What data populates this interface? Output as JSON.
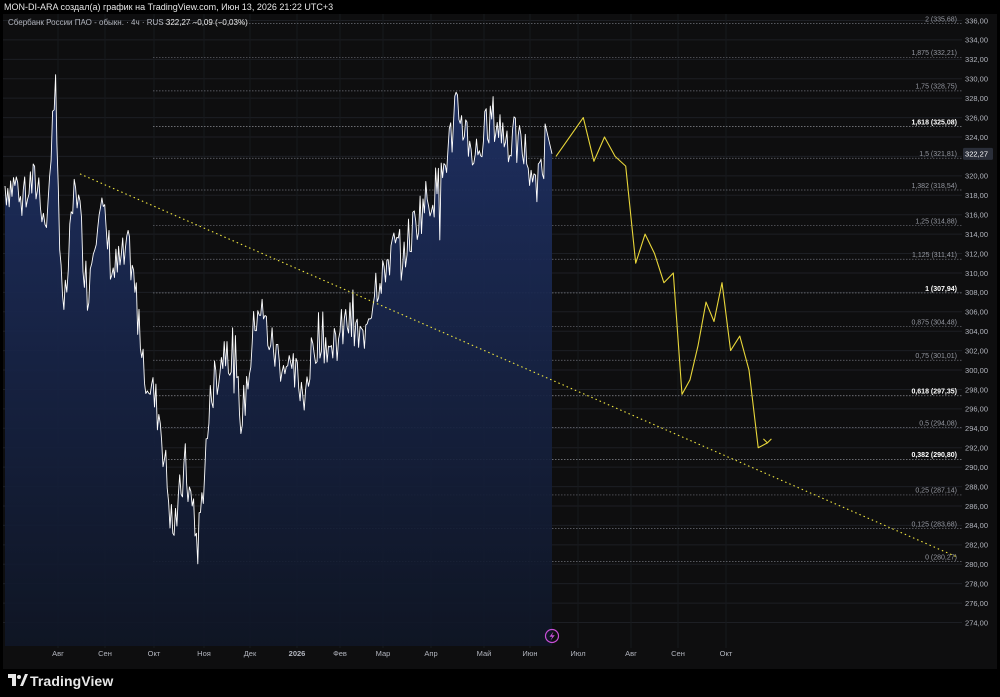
{
  "header": {
    "attribution": "MON-DI-ARA создал(а) график на TradingView.com, Июн 13, 2026 21:22 UTC+3"
  },
  "legend": {
    "symbol": "Сбербанк России ПАО - обыкн. · 4ч · RUS",
    "last": "322,27",
    "change": "−0,09 (−0,03%)"
  },
  "footer": {
    "brand": "TradingView"
  },
  "colors": {
    "background": "#0e0e0f",
    "price_line": "#ffffff",
    "area_fill": "#1c2c5a",
    "projection": "#e8d63a",
    "trendline": "#f0e640",
    "fib_line": "#6e7079",
    "axis_text": "#b2b5be",
    "badge": "#2a2e39",
    "lightning_icon": "#c84fd6"
  },
  "chart_data": {
    "type": "line",
    "title": "Сбербанк России ПАО - обыкн. · 4ч · RUS",
    "ylim": [
      274,
      336
    ],
    "yticks": [
      274,
      276,
      278,
      280,
      282,
      284,
      286,
      288,
      290,
      292,
      294,
      296,
      298,
      300,
      302,
      304,
      306,
      308,
      310,
      312,
      314,
      316,
      318,
      320,
      322,
      324,
      326,
      328,
      330,
      332,
      334,
      336
    ],
    "ytick_labels": [
      "274,00",
      "276,00",
      "278,00",
      "280,00",
      "282,00",
      "284,00",
      "286,00",
      "288,00",
      "290,00",
      "292,00",
      "294,00",
      "296,00",
      "298,00",
      "300,00",
      "302,00",
      "304,00",
      "306,00",
      "308,00",
      "310,00",
      "312,00",
      "314,00",
      "316,00",
      "318,00",
      "320,00",
      "322,00",
      "324,00",
      "326,00",
      "328,00",
      "330,00",
      "332,00",
      "334,00",
      "336,00"
    ],
    "x_axis": [
      "Авг",
      "Сен",
      "Окт",
      "Ноя",
      "Дек",
      "2026",
      "Фев",
      "Мар",
      "Апр",
      "Май",
      "Июн",
      "Июл",
      "Авг",
      "Сен",
      "Окт"
    ],
    "grid": true,
    "last_price": 322.27,
    "last_price_label": "322,27",
    "series": [
      {
        "type": "area",
        "style": "price",
        "x": [
          "Июл",
          "Июл",
          "Июл",
          "Авг",
          "Авг",
          "Авг",
          "Авг",
          "Сен",
          "Сен",
          "Сен",
          "Окт",
          "Окт",
          "Окт",
          "Окт",
          "Ноя",
          "Ноя",
          "Ноя",
          "Дек",
          "Дек",
          "Дек",
          "2026",
          "2026",
          "2026",
          "Фев",
          "Фев",
          "Фев",
          "Мар",
          "Мар",
          "Мар",
          "Апр",
          "Апр",
          "Апр",
          "Май",
          "Май",
          "Май",
          "Июн",
          "Июн"
        ],
        "values": [
          319,
          315,
          328,
          305,
          320,
          308,
          318,
          310,
          312,
          300,
          295,
          283,
          290,
          282,
          298,
          303,
          295,
          307,
          302,
          300,
          298,
          304,
          302,
          305,
          303,
          309,
          312,
          313,
          317,
          319,
          327,
          322,
          326,
          324,
          323,
          320,
          322.27
        ]
      },
      {
        "type": "line",
        "style": "projection",
        "x": [
          "Июн",
          "Июл",
          "Июл",
          "Июл",
          "Июл",
          "Июл",
          "Авг",
          "Авг",
          "Авг",
          "Авг",
          "Авг",
          "Сен",
          "Сен",
          "Сен",
          "Сен",
          "Сен",
          "Сен",
          "Окт",
          "Окт",
          "Окт",
          "Окт",
          "Окт"
        ],
        "values": [
          322,
          326,
          321.5,
          324,
          322,
          321,
          311,
          314,
          312,
          309,
          310,
          297.5,
          299,
          302.5,
          307,
          305,
          309,
          302,
          303.5,
          300,
          292,
          292.5
        ]
      },
      {
        "type": "line",
        "style": "dotted-trendline",
        "x": [
          "Авг",
          "Окт"
        ],
        "values": [
          320.2,
          280.7
        ]
      }
    ],
    "fib_levels": [
      {
        "ratio": "0",
        "price": 280.27,
        "label": "0 (280,27)",
        "bold": false
      },
      {
        "ratio": "0,125",
        "price": 283.68,
        "label": "0,125 (283,68)",
        "bold": false
      },
      {
        "ratio": "0,25",
        "price": 287.14,
        "label": "0,25 (287,14)",
        "bold": false
      },
      {
        "ratio": "0,382",
        "price": 290.8,
        "label": "0,382 (290,80)",
        "bold": true
      },
      {
        "ratio": "0,5",
        "price": 294.08,
        "label": "0,5 (294,08)",
        "bold": false
      },
      {
        "ratio": "0,618",
        "price": 297.35,
        "label": "0,618 (297,35)",
        "bold": true
      },
      {
        "ratio": "0,75",
        "price": 301.01,
        "label": "0,75 (301,01)",
        "bold": false
      },
      {
        "ratio": "0,875",
        "price": 304.48,
        "label": "0,875 (304,48)",
        "bold": false
      },
      {
        "ratio": "1",
        "price": 307.94,
        "label": "1 (307,94)",
        "bold": true
      },
      {
        "ratio": "1,125",
        "price": 311.41,
        "label": "1,125 (311,41)",
        "bold": false
      },
      {
        "ratio": "1,25",
        "price": 314.88,
        "label": "1,25 (314,88)",
        "bold": false
      },
      {
        "ratio": "1,382",
        "price": 318.54,
        "label": "1,382 (318,54)",
        "bold": false
      },
      {
        "ratio": "1,5",
        "price": 321.81,
        "label": "1,5 (321,81)",
        "bold": false
      },
      {
        "ratio": "1,618",
        "price": 325.08,
        "label": "1,618 (325,08)",
        "bold": true
      },
      {
        "ratio": "1,75",
        "price": 328.75,
        "label": "1,75 (328,75)",
        "bold": false
      },
      {
        "ratio": "1,875",
        "price": 332.21,
        "label": "1,875 (332,21)",
        "bold": false
      },
      {
        "ratio": "2",
        "price": 335.68,
        "label": "2 (335,68)",
        "bold": false
      }
    ]
  }
}
